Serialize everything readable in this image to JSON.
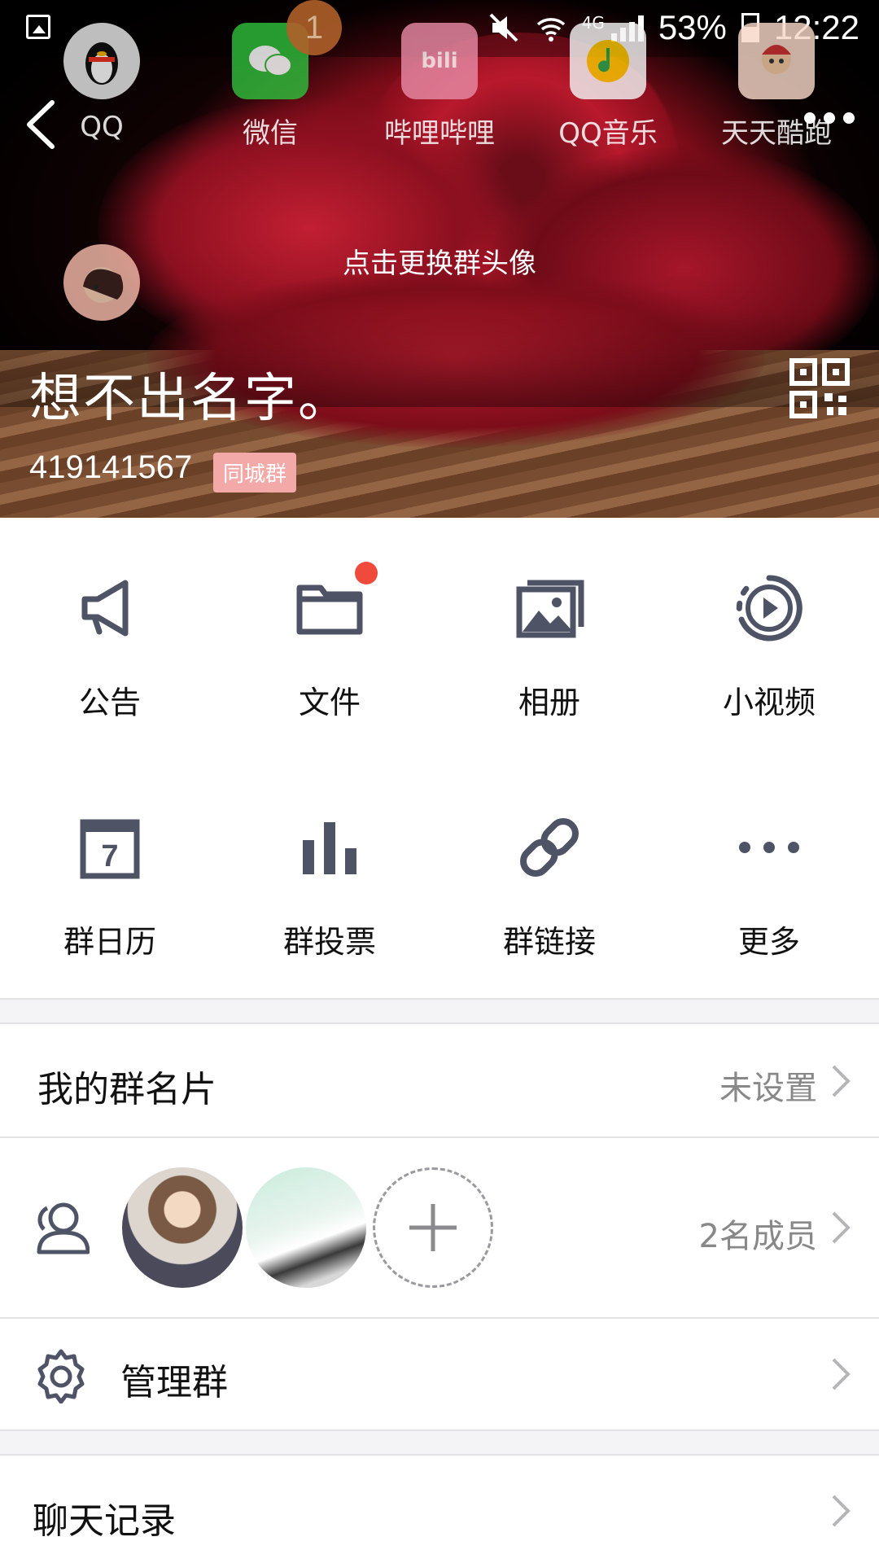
{
  "status_bar": {
    "network": "4G",
    "battery": "53%",
    "time": "12:22"
  },
  "launcher_icons": [
    {
      "label": "QQ",
      "icon": "qq-penguin-icon",
      "color": "#e8e8e8"
    },
    {
      "label": "微信",
      "icon": "wechat-icon",
      "color": "#2fbd3b",
      "badge": "1"
    },
    {
      "label": "哔哩哔哩",
      "icon": "bilibili-icon",
      "color": "#f48fb1"
    },
    {
      "label": "QQ音乐",
      "icon": "qq-music-icon",
      "color": "#f2f2f2"
    },
    {
      "label": "天天酷跑",
      "icon": "game-icon",
      "color": "#f6d7c7"
    }
  ],
  "header": {
    "change_avatar": "点击更换群头像",
    "group_name": "想不出名字。",
    "group_id": "419141567",
    "city_tag": "同城群"
  },
  "grid": [
    {
      "label": "公告",
      "icon": "megaphone-icon"
    },
    {
      "label": "文件",
      "icon": "folder-icon",
      "dot": true
    },
    {
      "label": "相册",
      "icon": "photo-album-icon"
    },
    {
      "label": "小视频",
      "icon": "video-play-icon"
    },
    {
      "label": "群日历",
      "icon": "calendar-icon",
      "calendar_day": "7"
    },
    {
      "label": "群投票",
      "icon": "bar-chart-icon"
    },
    {
      "label": "群链接",
      "icon": "link-icon"
    },
    {
      "label": "更多",
      "icon": "more-dots-icon"
    }
  ],
  "my_card": {
    "label": "我的群名片",
    "value": "未设置"
  },
  "members": {
    "count_label": "2名成员"
  },
  "manage": {
    "label": "管理群"
  },
  "chat_history": {
    "label": "聊天记录"
  },
  "colors": {
    "icon_gray": "#4f5366",
    "red_dot": "#f04a3c",
    "tag_pink": "#f2a9a8"
  }
}
